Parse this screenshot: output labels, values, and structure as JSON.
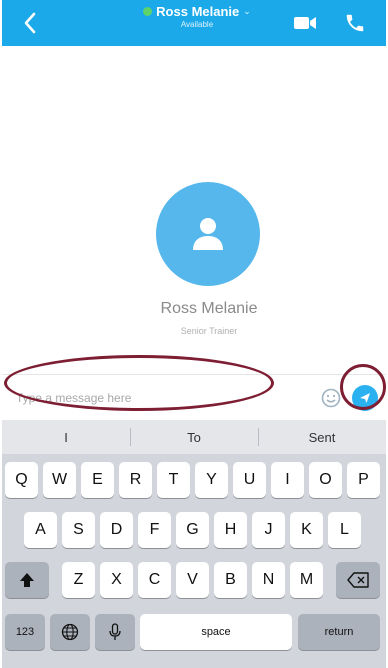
{
  "header": {
    "contact_name": "Ross Melanie",
    "chevron": "⌄",
    "status": "Available",
    "back_icon": "chevron-left-icon",
    "video_icon": "video-camera-icon",
    "call_icon": "phone-icon",
    "accent": "#1ca9ea",
    "presence_color": "#5cd36b"
  },
  "profile": {
    "name": "Ross Melanie",
    "title": "Senior Trainer",
    "avatar_icon": "person-icon",
    "avatar_color": "#56b7ec"
  },
  "composer": {
    "placeholder": "Type a message here",
    "emoji_icon": "emoji-icon",
    "send_icon": "send-icon",
    "send_color": "#2bb0f0"
  },
  "annotation_color": "#7d1e33",
  "keyboard": {
    "suggestions": [
      "I",
      "To",
      "Sent"
    ],
    "row1": [
      "Q",
      "W",
      "E",
      "R",
      "T",
      "Y",
      "U",
      "I",
      "O",
      "P"
    ],
    "row2": [
      "A",
      "S",
      "D",
      "F",
      "G",
      "H",
      "J",
      "K",
      "L"
    ],
    "row3": [
      "Z",
      "X",
      "C",
      "V",
      "B",
      "N",
      "M"
    ],
    "numbers_key": "123",
    "space_key": "space",
    "return_key": "return",
    "shift_icon": "shift-icon",
    "backspace_icon": "backspace-icon",
    "globe_icon": "globe-icon",
    "mic_icon": "microphone-icon"
  }
}
